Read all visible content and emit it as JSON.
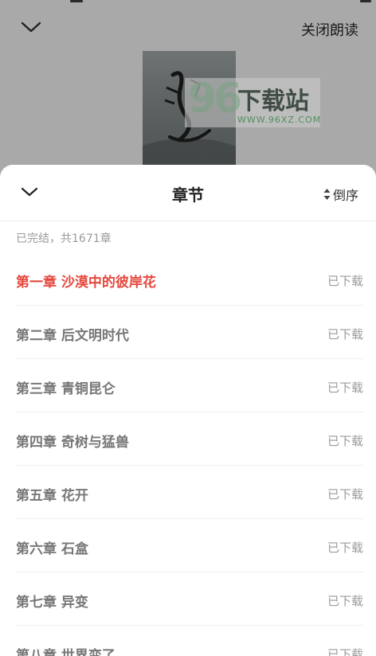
{
  "reader": {
    "close_reading_label": "关闭朗读"
  },
  "watermark": {
    "number": "96",
    "title": "下载站",
    "url": "WWW.96XZ.COM"
  },
  "panel": {
    "title": "章节",
    "sort_label": "倒序",
    "summary": "已完结，共1671章"
  },
  "colors": {
    "active_chapter": "#e5483e",
    "inactive_chapter": "#777777",
    "status_text": "#9a9a9a"
  },
  "chapters": [
    {
      "name": "第一章 沙漠中的彼岸花",
      "status": "已下载",
      "active": true
    },
    {
      "name": "第二章 后文明时代",
      "status": "已下载",
      "active": false
    },
    {
      "name": "第三章 青铜昆仑",
      "status": "已下载",
      "active": false
    },
    {
      "name": "第四章 奇树与猛兽",
      "status": "已下载",
      "active": false
    },
    {
      "name": "第五章 花开",
      "status": "已下载",
      "active": false
    },
    {
      "name": "第六章 石盒",
      "status": "已下载",
      "active": false
    },
    {
      "name": "第七章 异变",
      "status": "已下载",
      "active": false
    },
    {
      "name": "第八章 世界变了",
      "status": "已下载",
      "active": false
    }
  ]
}
